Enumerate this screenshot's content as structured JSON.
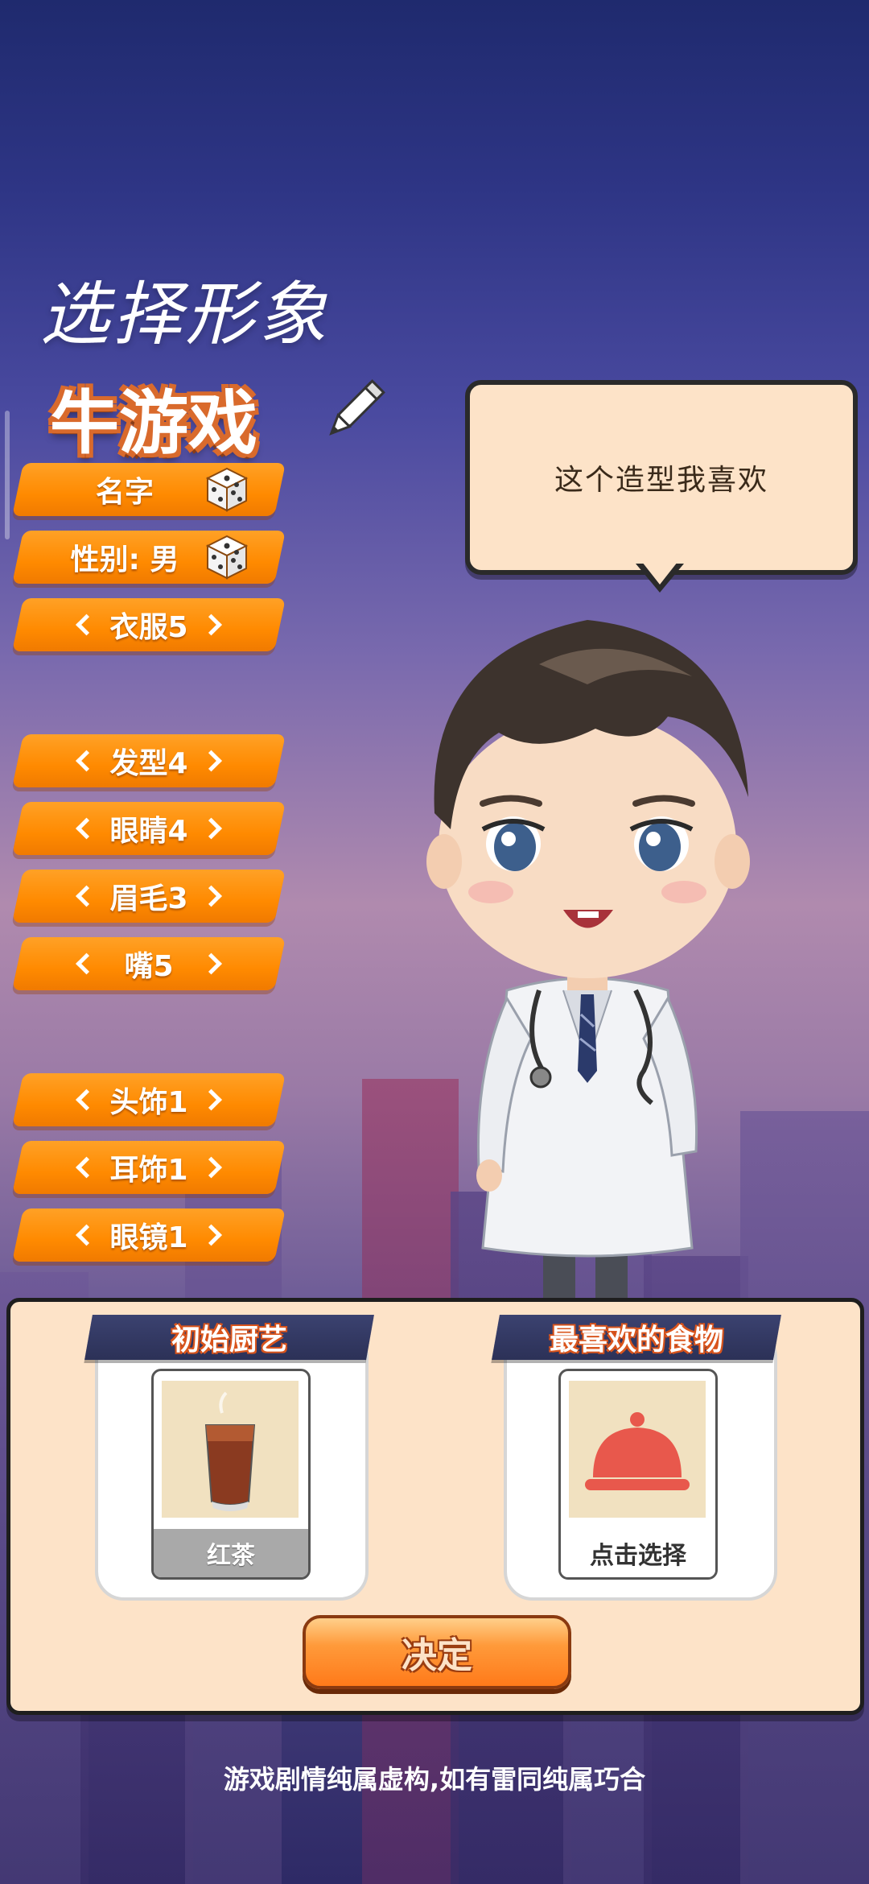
{
  "title": "选择形象",
  "player_name": "牛游戏",
  "speech": "这个造型我喜欢",
  "options": {
    "name": "名字",
    "gender": "性别: 男",
    "clothes": "衣服5",
    "hair": "发型4",
    "eyes": "眼睛4",
    "brows": "眉毛3",
    "mouth": "嘴5",
    "headwear": "头饰1",
    "earring": "耳饰1",
    "glasses": "眼镜1"
  },
  "cooking": {
    "title": "初始厨艺",
    "item": "红茶"
  },
  "food": {
    "title": "最喜欢的食物",
    "item": "点击选择"
  },
  "confirm": "决定",
  "disclaimer": "游戏剧情纯属虚构,如有雷同纯属巧合",
  "colors": {
    "accent": "#ff8a00",
    "panel": "#fde3c8"
  }
}
